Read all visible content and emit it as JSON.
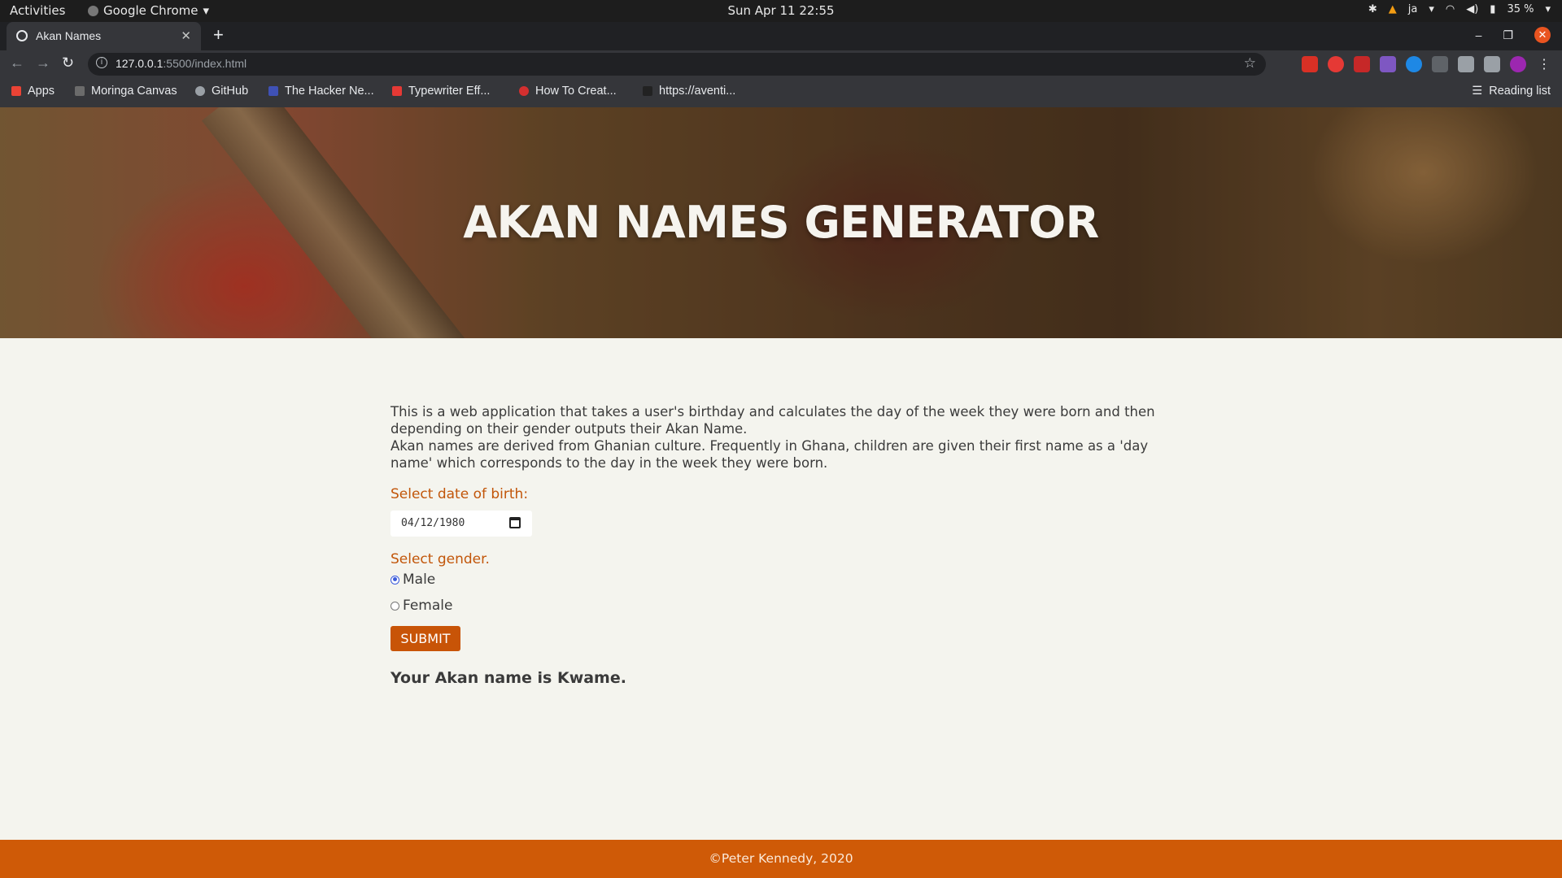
{
  "system": {
    "activities": "Activities",
    "app_name": "Google Chrome",
    "clock": "Sun Apr 11  22:55",
    "keyboard": "ja",
    "battery": "35 %"
  },
  "browser": {
    "tab_title": "Akan Names",
    "url_host": "127.0.0.1",
    "url_rest": ":5500/index.html",
    "bookmarks": [
      {
        "label": "Apps",
        "color": "#ea4335"
      },
      {
        "label": "Moringa Canvas",
        "color": "#6b6b6b"
      },
      {
        "label": "GitHub",
        "color": "#9aa0a6"
      },
      {
        "label": "The Hacker Ne...",
        "color": "#3f51b5"
      },
      {
        "label": "Typewriter Eff...",
        "color": "#e53935"
      },
      {
        "label": "How To Creat...",
        "color": "#d32f2f"
      },
      {
        "label": "https://aventi...",
        "color": "#222222"
      }
    ],
    "reading_list": "Reading list"
  },
  "page": {
    "title": "AKAN NAMES GENERATOR",
    "intro_1": "This is a web application that takes a user's birthday and calculates the day of the week they were born and then depending on their gender outputs their Akan Name.",
    "intro_2": "Akan names are derived from Ghanian culture. Frequently in Ghana, children are given their first name as a 'day name' which corresponds to the day in the week they were born.",
    "dob_label": "Select date of birth:",
    "dob_value": "04/12/1980",
    "gender_label": "Select gender.",
    "gender_options": [
      "Male",
      "Female"
    ],
    "selected_gender": "Male",
    "submit_label": "SUBMIT",
    "result": "Your Akan name is Kwame.",
    "footer": "©Peter Kennedy, 2020"
  },
  "colors": {
    "accent": "#c85407",
    "footer_bg": "#cf5a07",
    "page_bg": "#f4f4ee"
  }
}
